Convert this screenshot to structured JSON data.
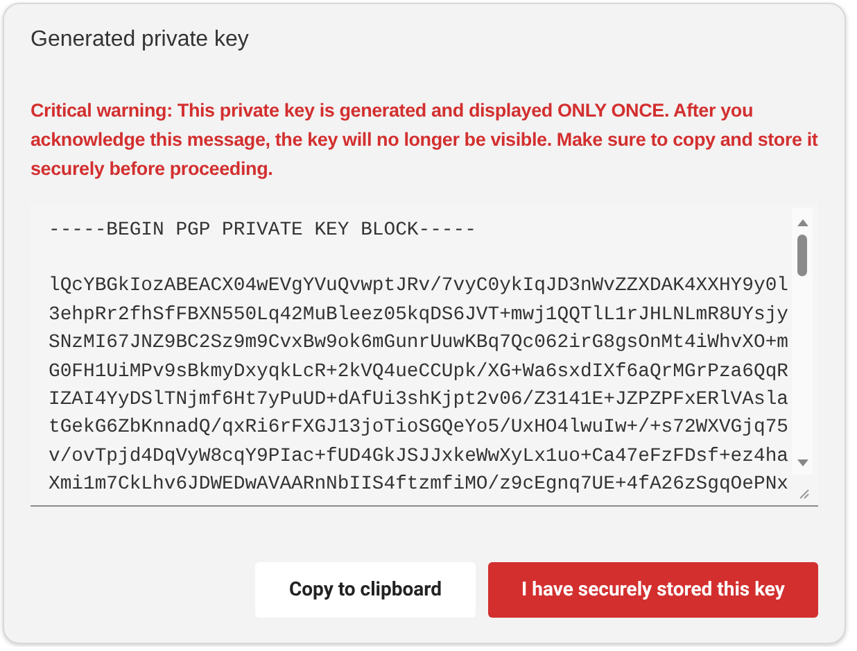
{
  "dialog": {
    "title": "Generated private key",
    "warning": "Critical warning: This private key is generated and displayed ONLY ONCE. After you acknowledge this message, the key will no longer be visible. Make sure to copy and store it securely before proceeding.",
    "key_field": {
      "header": "-----BEGIN PGP PRIVATE KEY BLOCK-----",
      "lines": [
        "lQcYBGkIozABEACX04wEVgYVuQvwptJRv/7vyC0ykIqJD3nWvZZXDAK4XXHY9y0l",
        "3ehpRr2fhSfFBXN550Lq42MuBleez05kqDS6JVT+mwj1QQTlL1rJHLNLmR8UYsjy",
        "SNzMI67JNZ9BC2Sz9m9CvxBw9ok6mGunrUuwKBq7Qc062irG8gsOnMt4iWhvXO+m",
        "G0FH1UiMPv9sBkmyDxyqkLcR+2kVQ4ueCCUpk/XG+Wa6sxdIXf6aQrMGrPza6QqR",
        "IZAI4YyDSlTNjmf6Ht7yPuUD+dAfUi3shKjpt2v06/Z3141E+JZPZPFxERlVAsla",
        "tGekG6ZbKnnadQ/qxRi6rFXGJ13joTioSGQeYo5/UxHO4lwuIw+/+s72WXVGjq75",
        "v/ovTpjd4DqVyW8cqY9PIac+fUD4GkJSJJxkeWwXyLx1uo+Ca47eFzFDsf+ez4ha",
        "Xmi1m7CkLhv6JDWEDwAVAARnNbIIS4ftzmfiMO/z9cEgnq7UE+4fA26zSgqOePNx"
      ]
    },
    "buttons": [
      {
        "label": "Copy to clipboard",
        "kind": "secondary"
      },
      {
        "label": "I have securely stored this key",
        "kind": "primary"
      }
    ]
  }
}
